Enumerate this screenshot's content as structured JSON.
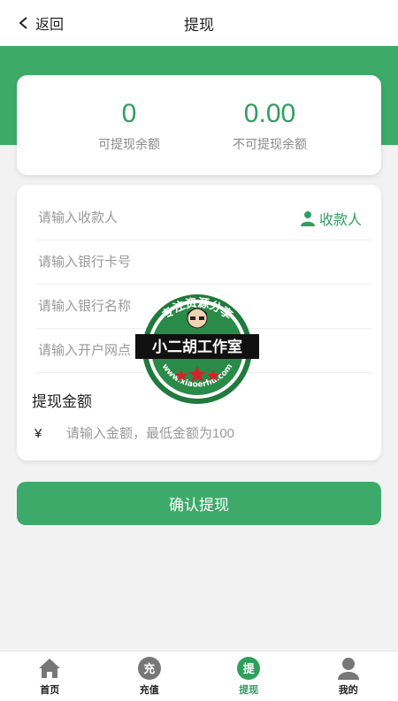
{
  "header": {
    "back_label": "返回",
    "title": "提现"
  },
  "balance": {
    "available_value": "0",
    "available_label": "可提现余额",
    "unavailable_value": "0.00",
    "unavailable_label": "不可提现余额"
  },
  "form": {
    "payee_placeholder": "请输入收款人",
    "payee_button_label": "收款人",
    "card_placeholder": "请输入银行卡号",
    "bank_placeholder": "请输入银行名称",
    "branch_placeholder": "请输入开户网点",
    "amount_title": "提现金额",
    "currency_symbol": "¥",
    "amount_placeholder": "请输入金额，最低金额为100"
  },
  "confirm_label": "确认提现",
  "watermark": {
    "top_text": "专注资源分享",
    "banner_text": "小二胡工作室",
    "url_text": "www.xiaoerhu.com"
  },
  "tabbar": {
    "items": [
      {
        "label": "首页",
        "icon": "home-icon"
      },
      {
        "label": "充值",
        "icon": "recharge-icon",
        "glyph": "充"
      },
      {
        "label": "提现",
        "icon": "withdraw-icon",
        "glyph": "提",
        "active": true
      },
      {
        "label": "我的",
        "icon": "profile-icon"
      }
    ]
  },
  "colors": {
    "accent": "#3daa6a",
    "accent_text": "#2e9f5d",
    "background": "#f2f2f2"
  }
}
